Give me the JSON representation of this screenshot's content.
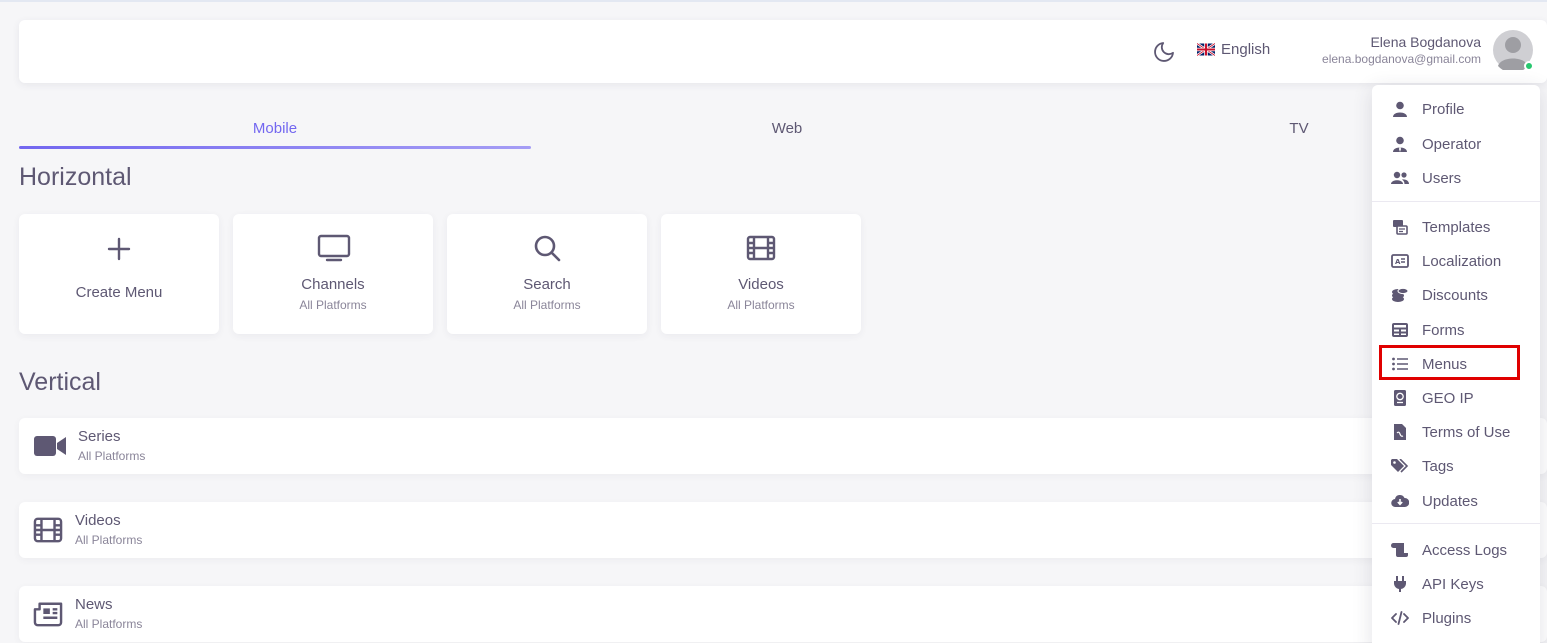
{
  "header": {
    "language": "English",
    "user_name": "Elena Bogdanova",
    "user_email": "elena.bogdanova@gmail.com",
    "status_color": "#28c76f"
  },
  "tabs": [
    {
      "label": "Mobile",
      "active": true
    },
    {
      "label": "Web",
      "active": false
    },
    {
      "label": "TV",
      "active": false
    }
  ],
  "horizontal": {
    "title": "Horizontal",
    "cards": [
      {
        "title": "Create Menu",
        "subtitle": "",
        "icon": "plus-icon"
      },
      {
        "title": "Channels",
        "subtitle": "All Platforms",
        "icon": "monitor-icon"
      },
      {
        "title": "Search",
        "subtitle": "All Platforms",
        "icon": "search-icon"
      },
      {
        "title": "Videos",
        "subtitle": "All Platforms",
        "icon": "film-icon"
      }
    ]
  },
  "vertical": {
    "title": "Vertical",
    "rows": [
      {
        "title": "Series",
        "subtitle": "All Platforms",
        "icon": "video-camera-icon"
      },
      {
        "title": "Videos",
        "subtitle": "All Platforms",
        "icon": "film-icon"
      },
      {
        "title": "News",
        "subtitle": "All Platforms",
        "icon": "newspaper-icon"
      }
    ]
  },
  "dropdown": {
    "items": [
      {
        "label": "Profile",
        "icon": "user-icon"
      },
      {
        "label": "Operator",
        "icon": "operator-icon"
      },
      {
        "label": "Users",
        "icon": "users-icon"
      },
      {
        "label": "Templates",
        "icon": "templates-icon"
      },
      {
        "label": "Localization",
        "icon": "localization-icon"
      },
      {
        "label": "Discounts",
        "icon": "coins-icon"
      },
      {
        "label": "Forms",
        "icon": "table-icon"
      },
      {
        "label": "Menus",
        "icon": "list-icon"
      },
      {
        "label": "GEO IP",
        "icon": "passport-icon"
      },
      {
        "label": "Terms of Use",
        "icon": "document-icon"
      },
      {
        "label": "Tags",
        "icon": "tags-icon"
      },
      {
        "label": "Updates",
        "icon": "cloud-download-icon"
      },
      {
        "label": "Access Logs",
        "icon": "scroll-icon"
      },
      {
        "label": "API Keys",
        "icon": "plug-icon"
      },
      {
        "label": "Plugins",
        "icon": "code-icon"
      }
    ],
    "highlighted": "Menus",
    "highlight_color": "#e00000"
  },
  "colors": {
    "accent": "#7367f0",
    "text": "#5e5873",
    "muted": "#8a8599",
    "icon": "#5e5873"
  }
}
